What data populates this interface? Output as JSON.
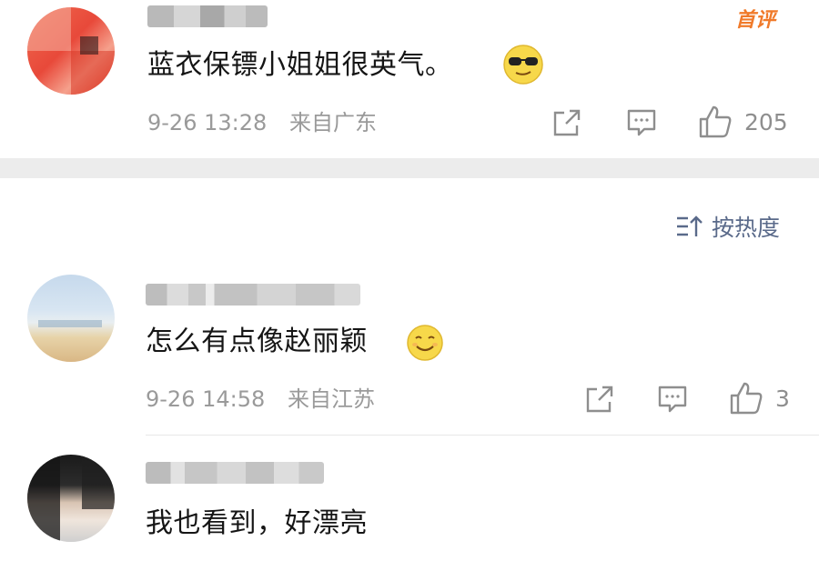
{
  "comments": [
    {
      "badge": "首评",
      "text": "蓝衣保镖小姐姐很英气。",
      "emoji_icon": "sunglasses-face-emoji",
      "time": "9-26 13:28",
      "location": "来自广东",
      "like_count": "205"
    },
    {
      "text": "怎么有点像赵丽颖",
      "emoji_icon": "smiling-face-emoji",
      "time": "9-26 14:58",
      "location": "来自江苏",
      "like_count": "3"
    },
    {
      "text": "我也看到，好漂亮"
    }
  ],
  "sort": {
    "label": "按热度",
    "icon": "sort-icon"
  },
  "colors": {
    "badge": "#f07a2a",
    "text": "#151515",
    "meta": "#9a9a9a",
    "divider": "#ececec"
  }
}
